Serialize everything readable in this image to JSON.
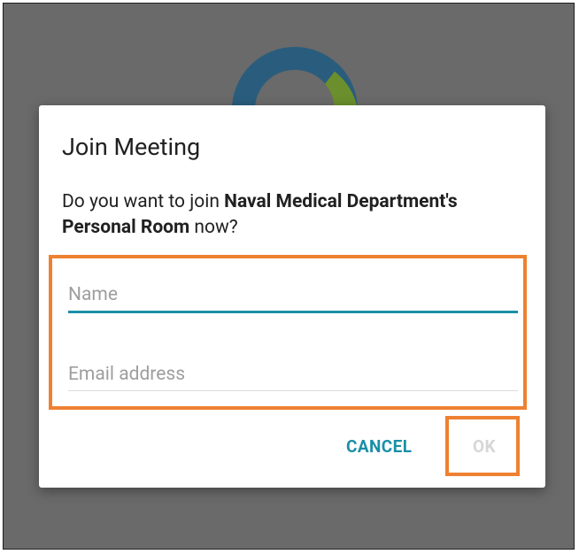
{
  "dialog": {
    "title": "Join Meeting",
    "message_prefix": "Do you want to join ",
    "message_bold": "Naval Medical Department's Personal Room",
    "message_suffix": " now?",
    "name_field": {
      "value": "",
      "placeholder": "Name"
    },
    "email_field": {
      "value": "",
      "placeholder": "Email address"
    },
    "cancel_label": "CANCEL",
    "ok_label": "OK"
  },
  "colors": {
    "accent": "#1b8fa6",
    "highlight": "#ee8131",
    "overlay": "#6a6a6a",
    "disabled_text": "#d6d6d6"
  },
  "icons": {
    "background_logo": "app-logo-icon"
  }
}
